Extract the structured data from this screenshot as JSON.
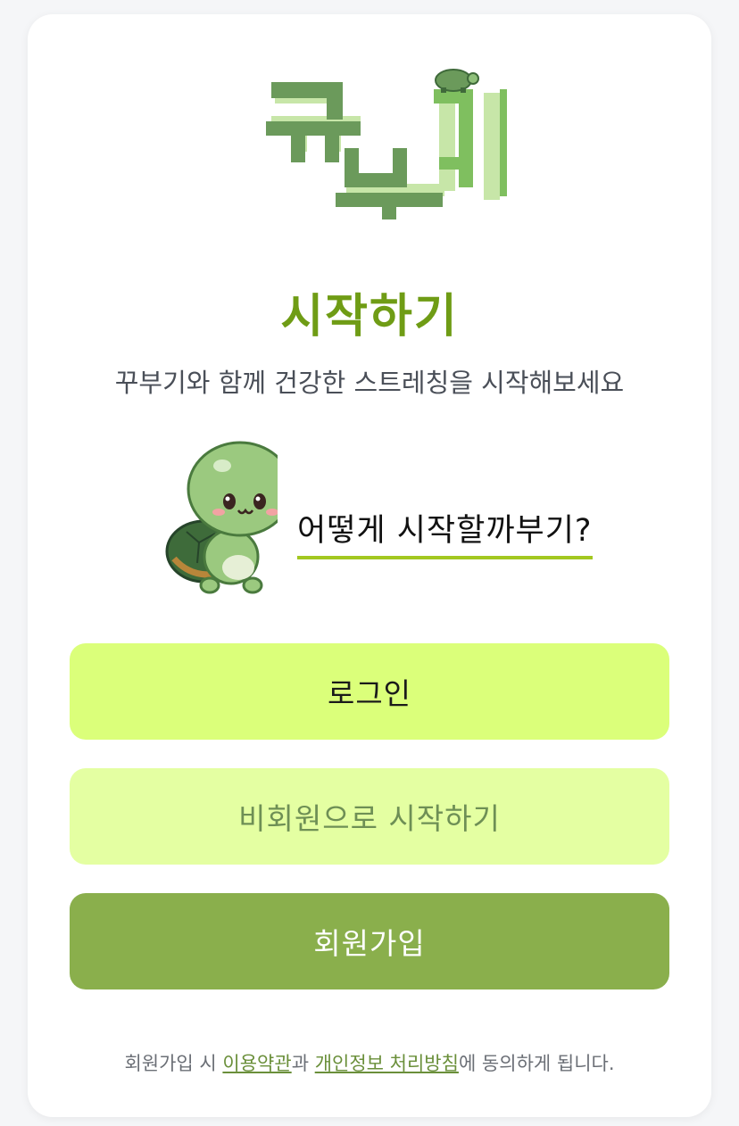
{
  "brand": {
    "logo_text": "꾸부기"
  },
  "header": {
    "title": "시작하기",
    "subtitle": "꾸부기와 함께 건강한 스트레칭을 시작해보세요"
  },
  "mascot": {
    "question": "어떻게 시작할까부기?"
  },
  "actions": {
    "login_label": "로그인",
    "guest_label": "비회원으로 시작하기",
    "signup_label": "회원가입"
  },
  "footer": {
    "prefix": "회원가입 시 ",
    "terms_link": "이용약관",
    "middle": "과 ",
    "privacy_link": "개인정보 처리방침",
    "suffix": "에 동의하게 됩니다."
  },
  "colors": {
    "accent": "#6f9c15",
    "login_bg": "#dbff7a",
    "guest_bg": "#e4ffa2",
    "signup_bg": "#8aaf4c",
    "underline": "#a3c820"
  }
}
